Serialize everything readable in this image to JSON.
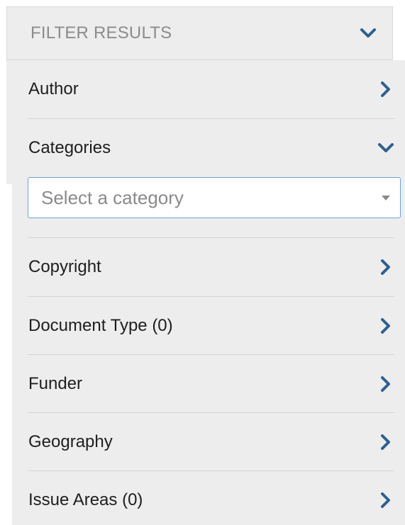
{
  "header": {
    "title": "FILTER RESULTS",
    "toggle_icon": "chevron-down-icon"
  },
  "filters": [
    {
      "label": "Author",
      "icon": "chevron-right-icon",
      "expanded": false
    },
    {
      "label": "Categories",
      "icon": "chevron-down-icon",
      "expanded": true
    },
    {
      "label": "Copyright",
      "icon": "chevron-right-icon",
      "expanded": false
    },
    {
      "label": "Document Type (0)",
      "icon": "chevron-right-icon",
      "expanded": false
    },
    {
      "label": "Funder",
      "icon": "chevron-right-icon",
      "expanded": false
    },
    {
      "label": "Geography",
      "icon": "chevron-right-icon",
      "expanded": false
    },
    {
      "label": "Issue Areas (0)",
      "icon": "chevron-right-icon",
      "expanded": false
    }
  ],
  "category_select": {
    "placeholder": "Select a category",
    "icon": "dropdown-caret-icon"
  },
  "colors": {
    "chevron": "#2f5f8e",
    "panel_bg": "#ededed",
    "select_border": "#6f9fd8",
    "divider": "#d3d3d3"
  }
}
